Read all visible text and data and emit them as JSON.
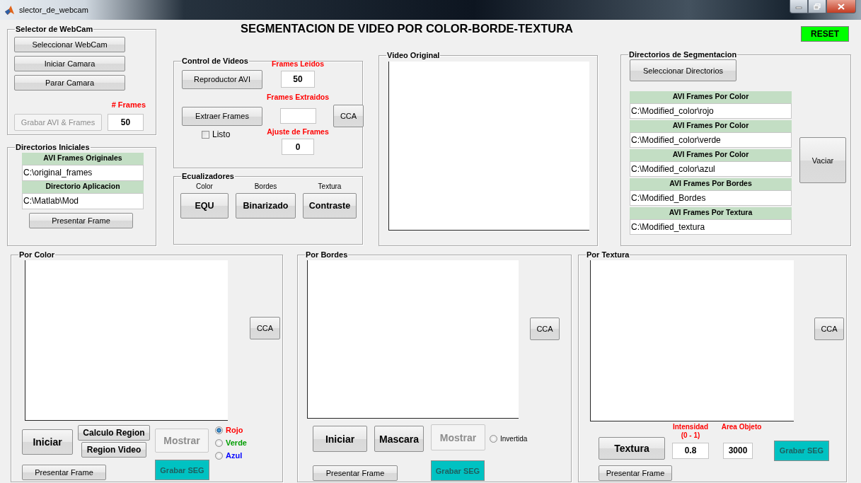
{
  "window": {
    "title": "slector_de_webcam"
  },
  "heading": "SEGMENTACION DE VIDEO POR COLOR-BORDE-TEXTURA",
  "reset_button": "RESET",
  "selector_webcam": {
    "title": "Selector de WebCam",
    "buttons": [
      "Seleccionar WebCam",
      "Iniciar Camara",
      "Parar Camara"
    ],
    "frames_label": "# Frames",
    "record_button": {
      "label": "Grabar  AVI & Frames",
      "disabled": true
    },
    "frames_value": "50"
  },
  "directorios_iniciales": {
    "title": "Directorios Iniciales",
    "fields": [
      {
        "label": "AVI Frames Originales",
        "value": "C:\\original_frames"
      },
      {
        "label": "Directorio Aplicacion",
        "value": "C:\\Matlab\\Mod"
      }
    ],
    "button": "Presentar Frame"
  },
  "control_videos": {
    "title": "Control de Videos",
    "frames_leidos_label": "Frames Leidos",
    "play_button": "Reproductor AVI",
    "frames_leidos": "50",
    "frames_extraidos_label": "Frames Extraidos",
    "extract_button": "Extraer Frames",
    "cca_button": "CCA",
    "listo": {
      "label": "Listo",
      "checked": false
    },
    "ajuste_label": "Ajuste de Frames",
    "ajuste": "0"
  },
  "ecualizadores": {
    "title": "Ecualizadores",
    "items": [
      {
        "label": "Color",
        "button": "EQU"
      },
      {
        "label": "Bordes",
        "button": "Binarizado"
      },
      {
        "label": "Textura",
        "button": "Contraste"
      }
    ]
  },
  "video_original": {
    "title": "Video Original"
  },
  "directorios_segmentacion": {
    "title": "Directorios de Segmentacion",
    "select_button": "Seleccionar Directorios",
    "fields": [
      {
        "label": "AVI Frames Por Color",
        "value": "C:\\Modified_color\\rojo"
      },
      {
        "label": "AVI Frames Por Color",
        "value": "C:\\Modified_color\\verde"
      },
      {
        "label": "AVI Frames Por Color",
        "value": "C:\\Modified_color\\azul"
      },
      {
        "label": "AVI Frames Por Bordes",
        "value": "C:\\Modified_Bordes"
      },
      {
        "label": "AVI Frames Por Textura",
        "value": "C:\\Modified_textura"
      }
    ],
    "clear_button": "Vaciar"
  },
  "por_color": {
    "title": "Por Color",
    "cca_button": "CCA",
    "start_button": "Iniciar",
    "region_buttons": [
      "Calculo Region",
      "Region Video"
    ],
    "show_button": {
      "label": "Mostrar",
      "disabled": true
    },
    "radios": [
      {
        "label": "Rojo",
        "color": "#ff0000",
        "selected": true
      },
      {
        "label": "Verde",
        "color": "#009e00",
        "selected": false
      },
      {
        "label": "Azul",
        "color": "#0000ff",
        "selected": false
      }
    ],
    "present_button": "Presentar Frame",
    "save_button": {
      "label": "Grabar SEG",
      "disabled": true
    }
  },
  "por_bordes": {
    "title": "Por Bordes",
    "cca_button": "CCA",
    "start_button": "Iniciar",
    "mask_button": "Mascara",
    "show_button": {
      "label": "Mostrar",
      "disabled": true
    },
    "invert": {
      "label": "Invertida",
      "selected": false
    },
    "present_button": "Presentar Frame",
    "save_button": {
      "label": "Grabar SEG",
      "disabled": true
    }
  },
  "por_textura": {
    "title": "Por Textura",
    "cca_button": "CCA",
    "texture_button": "Textura",
    "intensity_label": "Intensidad\n(0 - 1)",
    "intensity": "0.8",
    "area_label": "Area Objeto",
    "area": "3000",
    "present_button": "Presentar Frame",
    "save_button": {
      "label": "Grabar SEG",
      "disabled": true
    }
  }
}
